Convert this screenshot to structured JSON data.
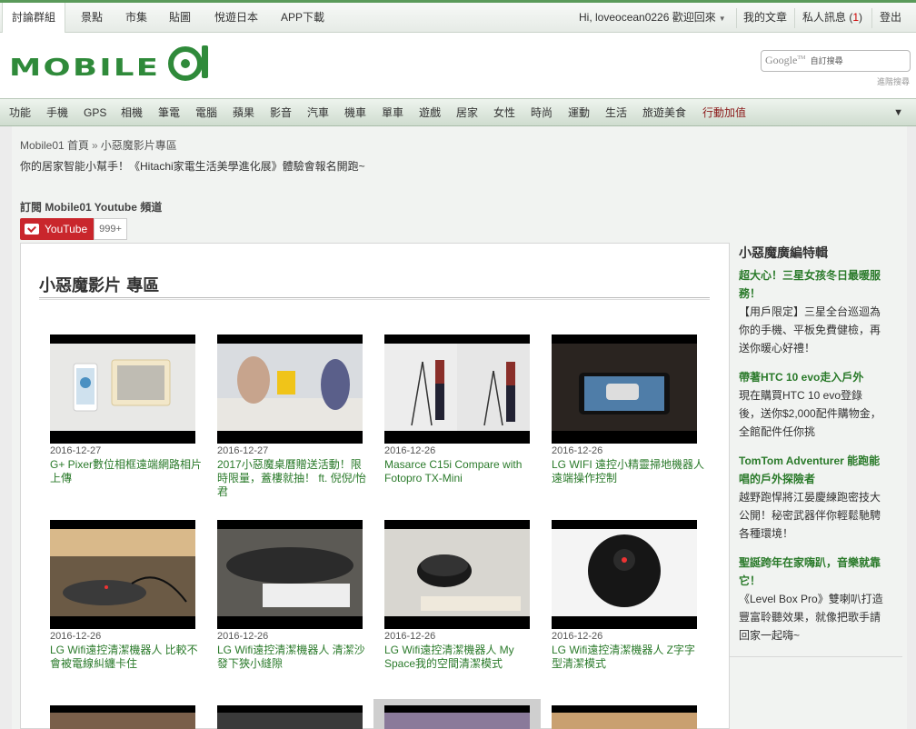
{
  "topbar": {
    "tabs": [
      {
        "label": "討論群組",
        "active": true
      },
      {
        "label": "景點"
      },
      {
        "label": "市集"
      },
      {
        "label": "貼圖"
      },
      {
        "label": "悅遊日本"
      },
      {
        "label": "APP下載"
      }
    ],
    "greeting": "Hi, loveocean0226 歡迎回來",
    "my_posts": "我的文章",
    "pm_label": "私人訊息 (",
    "pm_count": "1",
    "pm_close": ")",
    "logout": "登出"
  },
  "header": {
    "logo_text": "MOBILE01",
    "search_brand": "Google",
    "search_tm": "TM",
    "search_placeholder": "自訂搜尋",
    "search_hint": "進階搜尋"
  },
  "nav": {
    "items": [
      "功能",
      "手機",
      "GPS",
      "相機",
      "筆電",
      "電腦",
      "蘋果",
      "影音",
      "汽車",
      "機車",
      "單車",
      "遊戲",
      "居家",
      "女性",
      "時尚",
      "運動",
      "生活",
      "旅遊美食",
      "行動加值"
    ]
  },
  "breadcrumb": {
    "home": "Mobile01 首頁",
    "sep": "»",
    "current": "小惡魔影片專區"
  },
  "announcement": "你的居家智能小幫手！《Hitachi家電生活美學進化展》體驗會報名開跑~",
  "subscribe": {
    "label": "訂閱 Mobile01 Youtube 頻道",
    "button": "YouTube",
    "count": "999+"
  },
  "main": {
    "title": "小惡魔影片 專區",
    "videos": [
      {
        "date": "2016-12-27",
        "title": "G+ Pixer數位相框遠端網路相片上傳"
      },
      {
        "date": "2016-12-27",
        "title": "2017小惡魔桌曆贈送活動！限時限量，蓋樓就抽！ ft. 倪倪/怡君"
      },
      {
        "date": "2016-12-26",
        "title": "Masarce C15i Compare with Fotopro TX-Mini"
      },
      {
        "date": "2016-12-26",
        "title": "LG WIFI 遠控小精靈掃地機器人遠端操作控制"
      },
      {
        "date": "2016-12-26",
        "title": "LG Wifi遠控清潔機器人 比較不會被電線糾纏卡住"
      },
      {
        "date": "2016-12-26",
        "title": "LG Wifi遠控清潔機器人 清潔沙發下狹小縫隙"
      },
      {
        "date": "2016-12-26",
        "title": "LG Wifi遠控清潔機器人 My Space我的空間清潔模式"
      },
      {
        "date": "2016-12-26",
        "title": "LG Wifi遠控清潔機器人 Z字字型清潔模式"
      }
    ]
  },
  "sidebar": {
    "title": "小惡魔廣編特輯",
    "items": [
      {
        "heading": "超大心！三星女孩冬日最暖服務！",
        "desc": "【用戶限定】三星全台巡迴為你的手機、平板免費健檢，再送你暖心好禮！"
      },
      {
        "heading": "帶著HTC 10 evo走入戶外",
        "desc": "現在購買HTC 10 evo登錄後，送你$2,000配件購物金，全館配件任你挑"
      },
      {
        "heading": "TomTom Adventurer 能跑能唱的戶外探險者",
        "desc": "越野跑悍將江晏慶練跑密技大公開！秘密武器伴你輕鬆馳騁各種環境！"
      },
      {
        "heading": "聖誕跨年在家嗨趴，音樂就靠它！",
        "desc": "《Level Box Pro》雙喇叭打造豐富聆聽效果，就像把歌手請回家一起嗨~"
      }
    ]
  },
  "colors": {
    "accent_green": "#2a7a2a",
    "hot_red": "#8b1a1a",
    "youtube_red": "#c9262c"
  }
}
